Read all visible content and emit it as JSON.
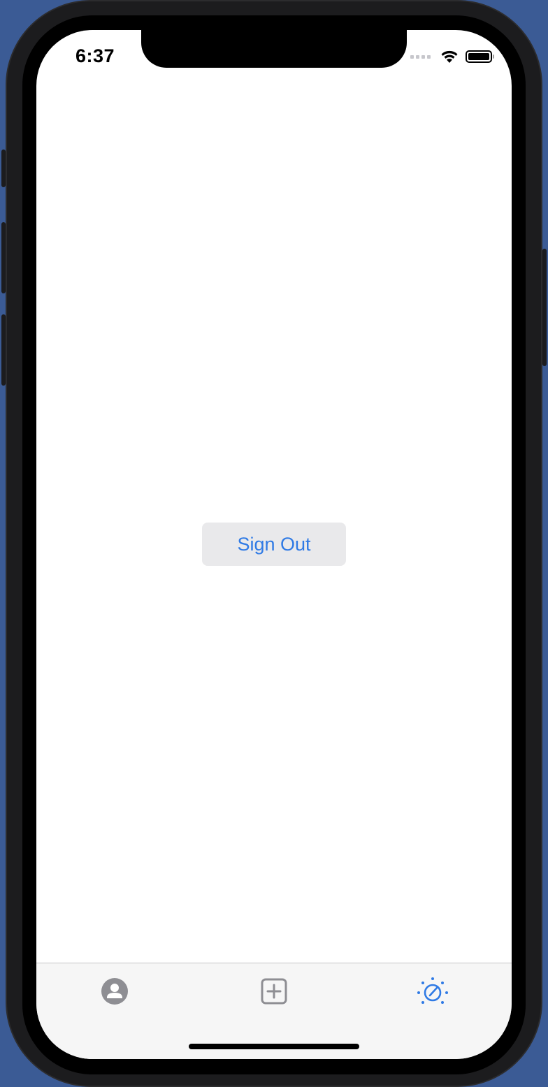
{
  "status_bar": {
    "time": "6:37",
    "icons": [
      "cellular-signal-icon",
      "wifi-icon",
      "battery-icon"
    ]
  },
  "main": {
    "sign_out_label": "Sign Out"
  },
  "tab_bar": {
    "tabs": [
      {
        "icon": "person-circle-icon",
        "selected": false
      },
      {
        "icon": "plus-square-icon",
        "selected": false
      },
      {
        "icon": "explore-dial-icon",
        "selected": true
      }
    ]
  },
  "colors": {
    "accent": "#2f7ae5",
    "tab_inactive": "#8e8e93",
    "button_bg": "#e9e9eb",
    "tab_bar_bg": "#f6f6f6",
    "background": "#3b5b95"
  }
}
